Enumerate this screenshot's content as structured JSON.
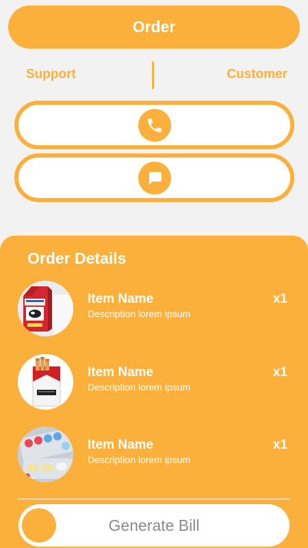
{
  "header": {
    "title": "Order"
  },
  "segments": {
    "left": "Support",
    "right": "Customer"
  },
  "contact": {
    "call_icon": "phone-icon",
    "chat_icon": "chat-bubble-icon"
  },
  "order_details": {
    "title": "Order Details",
    "items": [
      {
        "name": "Item Name",
        "description": "Description lorem ipsum",
        "quantity": "x1",
        "image": "milk-carton"
      },
      {
        "name": "Item Name",
        "description": "Description lorem ipsum",
        "quantity": "x1",
        "image": "cigarette-pack"
      },
      {
        "name": "Item Name",
        "description": "Description lorem ipsum",
        "quantity": "x1",
        "image": "pill-blister"
      }
    ]
  },
  "actions": {
    "generate_bill": "Generate Bill"
  },
  "colors": {
    "accent": "#fbb03b",
    "background": "#f2f2f2",
    "text_on_accent": "#ffffff",
    "muted_text": "#8a8a8a"
  }
}
